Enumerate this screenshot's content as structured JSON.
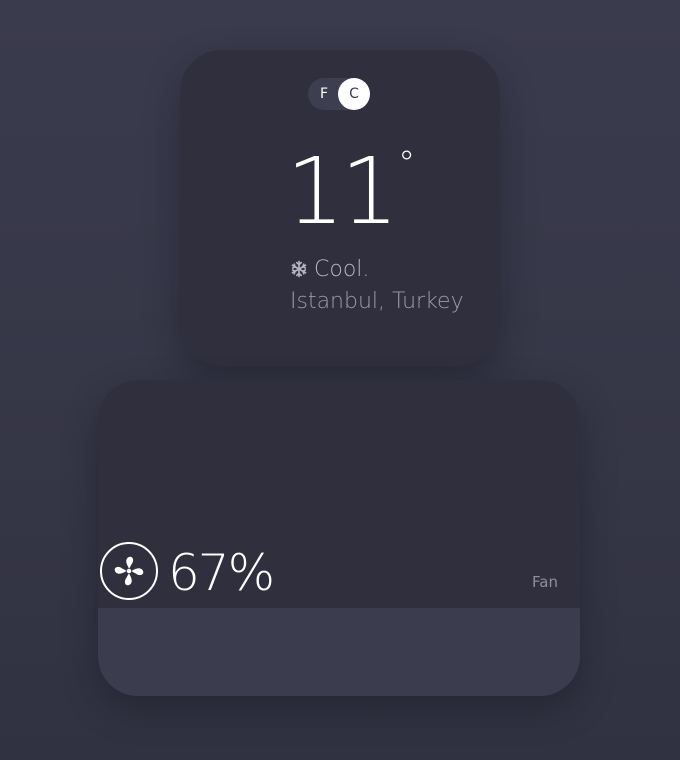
{
  "weather": {
    "unit_toggle": {
      "fahrenheit_label": "F",
      "celsius_label": "C",
      "selected": "C"
    },
    "temperature": "11",
    "degree_symbol": "°",
    "condition_icon": "snowflake-icon",
    "condition": "Cool.",
    "location": "Istanbul, Turkey"
  },
  "fan": {
    "icon": "fan-icon",
    "value_text": "67%",
    "level": 0.72,
    "label": "Fan"
  },
  "colors": {
    "background": "#363747",
    "card_dark": "#302f3d",
    "card_light": "#3b3c4e",
    "accent": "#ffffff",
    "muted_text": "#9b9cae"
  }
}
